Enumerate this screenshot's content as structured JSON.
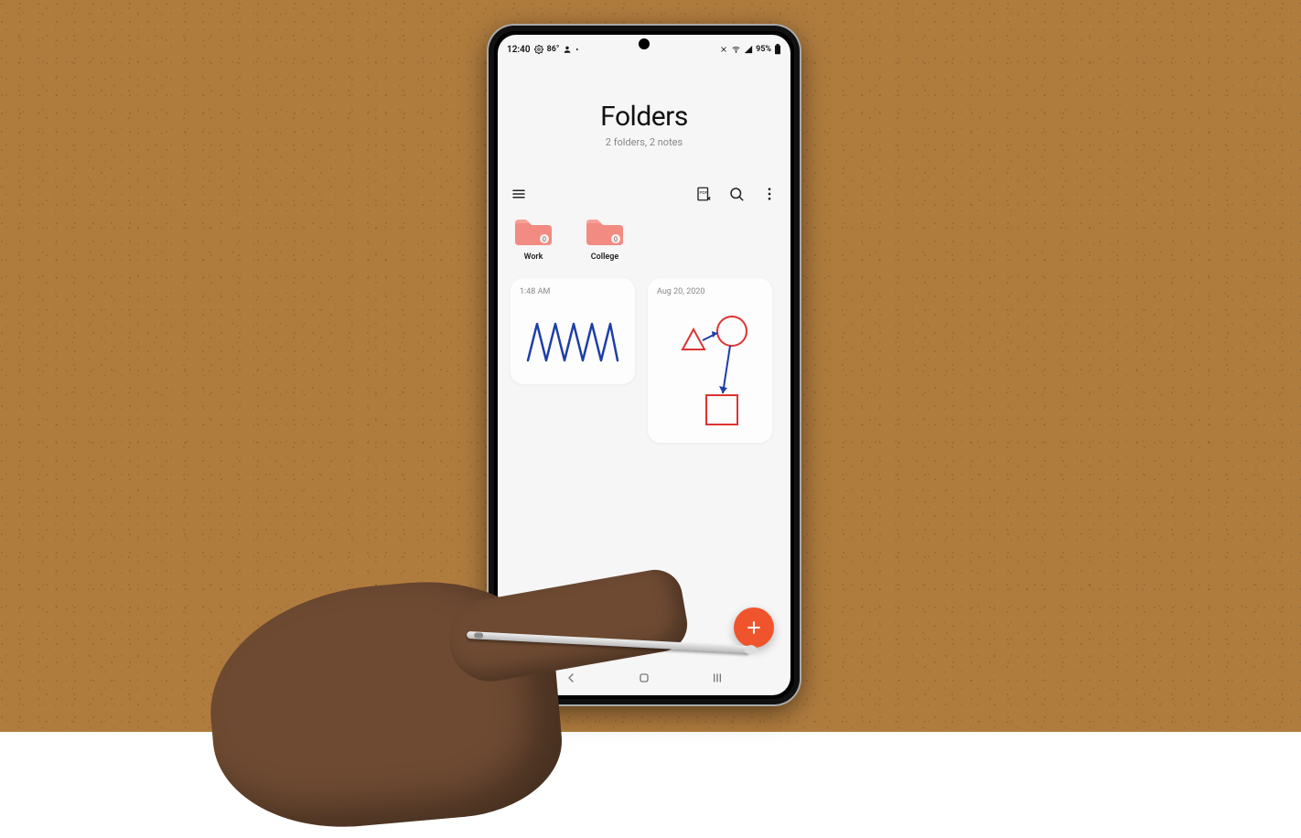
{
  "statusbar": {
    "time": "12:40",
    "temp": "86°",
    "battery": "95%"
  },
  "header": {
    "title": "Folders",
    "subtitle": "2 folders, 2 notes"
  },
  "folders": [
    {
      "name": "Work",
      "badge": "0"
    },
    {
      "name": "College",
      "badge": "0"
    }
  ],
  "notes": [
    {
      "meta": "1:48 AM"
    },
    {
      "meta": "Aug 20, 2020"
    }
  ],
  "colors": {
    "folder": "#f28b82",
    "fab": "#f0542d",
    "stroke_blue": "#1d3ea8",
    "stroke_red": "#d33"
  }
}
